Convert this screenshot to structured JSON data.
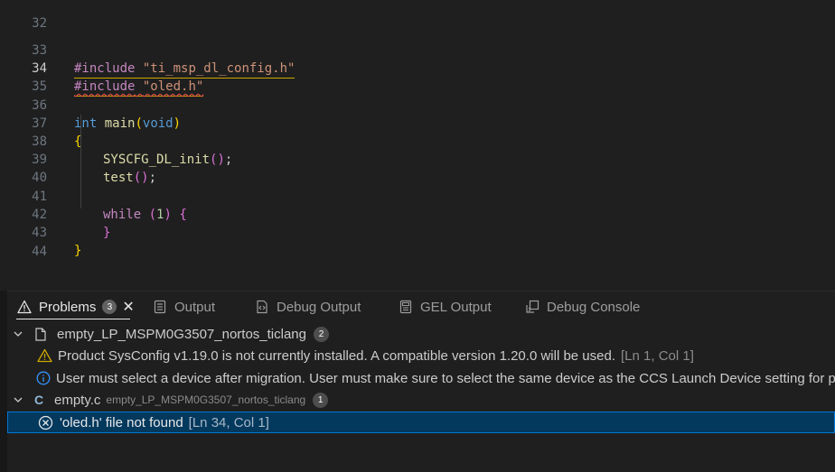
{
  "editor": {
    "lines": [
      {
        "num": "32"
      },
      {
        "num": "33",
        "pp": "#include",
        "str": "\"ti_msp_dl_config.h\""
      },
      {
        "num": "34",
        "pp": "#include",
        "str": "\"oled.h\""
      },
      {
        "num": "35"
      },
      {
        "num": "36",
        "type": "int",
        "fn": "main",
        "open": "(",
        "param": "void",
        "close": ")"
      },
      {
        "num": "37",
        "brace": "{"
      },
      {
        "num": "38",
        "fn": "SYSCFG_DL_init",
        "parens": "()",
        "semi": ";"
      },
      {
        "num": "39",
        "fn": "test",
        "parens": "()",
        "semi": ";"
      },
      {
        "num": "40"
      },
      {
        "num": "41",
        "kw": "while",
        "open": "(",
        "num_lit": "1",
        "close": ")",
        "brace": "{"
      },
      {
        "num": "42",
        "brace": "}"
      },
      {
        "num": "43",
        "brace": "}"
      },
      {
        "num": "44"
      }
    ]
  },
  "panel": {
    "tabs": [
      {
        "label": "Problems",
        "badge": "3",
        "icon": "warning-icon"
      },
      {
        "label": "Output",
        "icon": "output-icon"
      },
      {
        "label": "Debug Output",
        "icon": "debug-output-icon"
      },
      {
        "label": "GEL Output",
        "icon": "gel-output-icon"
      },
      {
        "label": "Debug Console",
        "icon": "debug-console-icon"
      }
    ],
    "close_symbol": "✕",
    "groups": [
      {
        "name": "empty_LP_MSPM0G3507_nortos_ticlang",
        "count": "2",
        "items": [
          {
            "severity": "warning",
            "message": "Product SysConfig v1.19.0 is not currently installed. A compatible version 1.20.0 will be used.",
            "location": "[Ln 1, Col 1]"
          },
          {
            "severity": "info",
            "message": "User must select a device after migration. User must make sure to select the same device as the CCS Launch Device setting for proper",
            "location": ""
          }
        ]
      },
      {
        "name": "empty.c",
        "path": "empty_LP_MSPM0G3507_nortos_ticlang",
        "count": "1",
        "items": [
          {
            "severity": "error",
            "message": "'oled.h' file not found",
            "location": "[Ln 34, Col 1]"
          }
        ]
      }
    ]
  },
  "colors": {
    "accent": "#0078d4",
    "selection": "#04395e",
    "warning": "#cca700",
    "info": "#3794ff",
    "error": "#f14c4c"
  }
}
